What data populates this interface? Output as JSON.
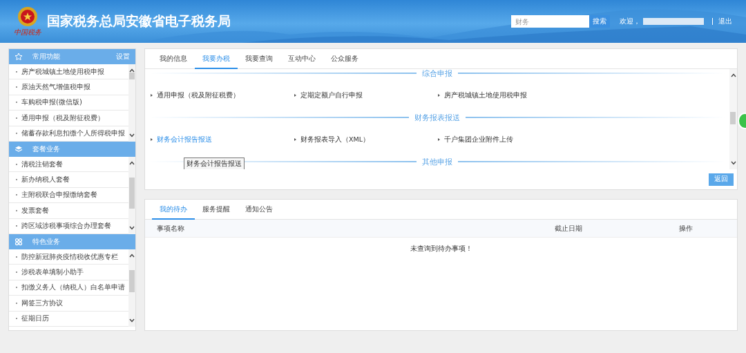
{
  "header": {
    "logo_text": "中国税务",
    "title": "国家税务总局安徽省电子税务局",
    "search": {
      "placeholder": "财务",
      "button": "搜索"
    },
    "welcome": "欢迎，",
    "logout": "退出"
  },
  "sidebar": [
    {
      "title": "常用功能",
      "action": "设置",
      "items": [
        "房产税城镇土地使用税申报",
        "原油天然气增值税申报",
        "车购税申报(微信版)",
        "通用申报（税及附征税费）",
        "储蓄存款利息扣缴个人所得税申报"
      ]
    },
    {
      "title": "套餐业务",
      "items": [
        "清税注销套餐",
        "新办纳税人套餐",
        "主附税联合申报缴纳套餐",
        "发票套餐",
        "跨区域涉税事项综合办理套餐"
      ]
    },
    {
      "title": "特色业务",
      "items": [
        "防控新冠肺炎疫情税收优惠专栏",
        "涉税表单填制小助手",
        "扣缴义务人（纳税人）白名单申请",
        "网签三方协议",
        "征期日历"
      ]
    }
  ],
  "main_tabs": [
    {
      "label": "我的信息",
      "selected": false
    },
    {
      "label": "我要办税",
      "selected": true
    },
    {
      "label": "我要查询",
      "selected": false
    },
    {
      "label": "互动中心",
      "selected": false
    },
    {
      "label": "公众服务",
      "selected": false
    }
  ],
  "sections": [
    {
      "title": "综合申报",
      "items": [
        {
          "label": "通用申报（税及附征税费）",
          "hovered": false
        },
        {
          "label": "定期定额户自行申报",
          "hovered": false
        },
        {
          "label": "房产税城镇土地使用税申报",
          "hovered": false
        }
      ]
    },
    {
      "title": "财务报表报送",
      "items": [
        {
          "label": "财务会计报告报送",
          "hovered": true
        },
        {
          "label": "财务报表导入（XML）",
          "hovered": false
        },
        {
          "label": "千户集团企业附件上传",
          "hovered": false
        }
      ]
    },
    {
      "title": "其他申报"
    }
  ],
  "tooltip": "财务会计报告报送",
  "back_button": "返回",
  "todo_tabs": [
    {
      "label": "我的待办",
      "selected": true
    },
    {
      "label": "服务提醒",
      "selected": false
    },
    {
      "label": "通知公告",
      "selected": false
    }
  ],
  "todo_table": {
    "columns": [
      "事项名称",
      "截止日期",
      "操作"
    ],
    "empty_message": "未查询到待办事项！"
  }
}
